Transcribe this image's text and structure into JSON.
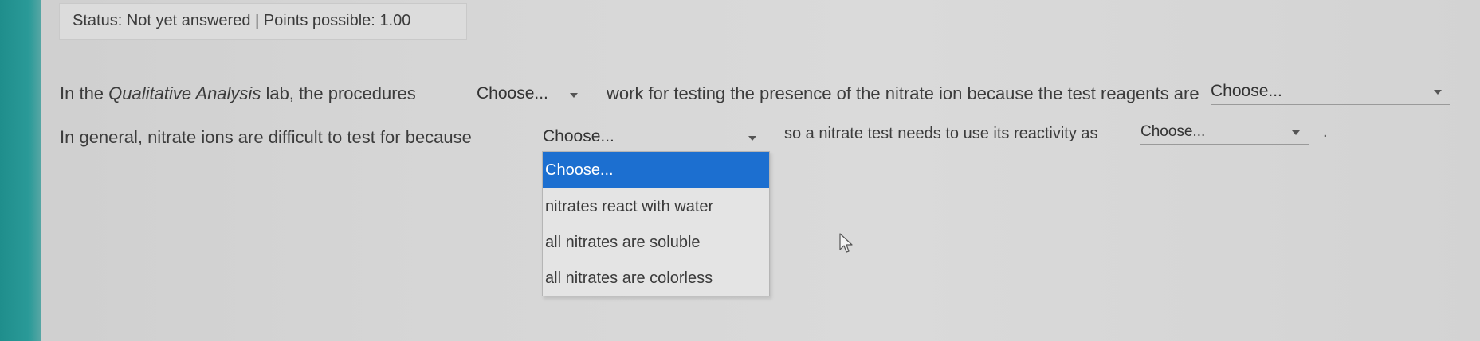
{
  "status": {
    "text": "Status: Not yet answered | Points possible: 1.00"
  },
  "line1": {
    "prefix": "In the ",
    "italic": "Qualitative Analysis",
    "mid": " lab, the procedures",
    "select1": "Choose...",
    "after_select1": "work for testing the presence of the nitrate ion because the test reagents are",
    "select2": "Choose..."
  },
  "line2": {
    "prefix": "In general, nitrate ions are difficult to test for because",
    "select3": "Choose...",
    "after_select3": "so a nitrate test needs to use its reactivity as",
    "select4": "Choose...",
    "trailing": "."
  },
  "dropdown": {
    "options": [
      "Choose...",
      "nitrates react with water",
      "all nitrates are soluble",
      "all nitrates are colorless"
    ],
    "selected_index": 0
  },
  "colors": {
    "highlight": "#1c6fd0",
    "sidebar": "#1f8e8c"
  }
}
